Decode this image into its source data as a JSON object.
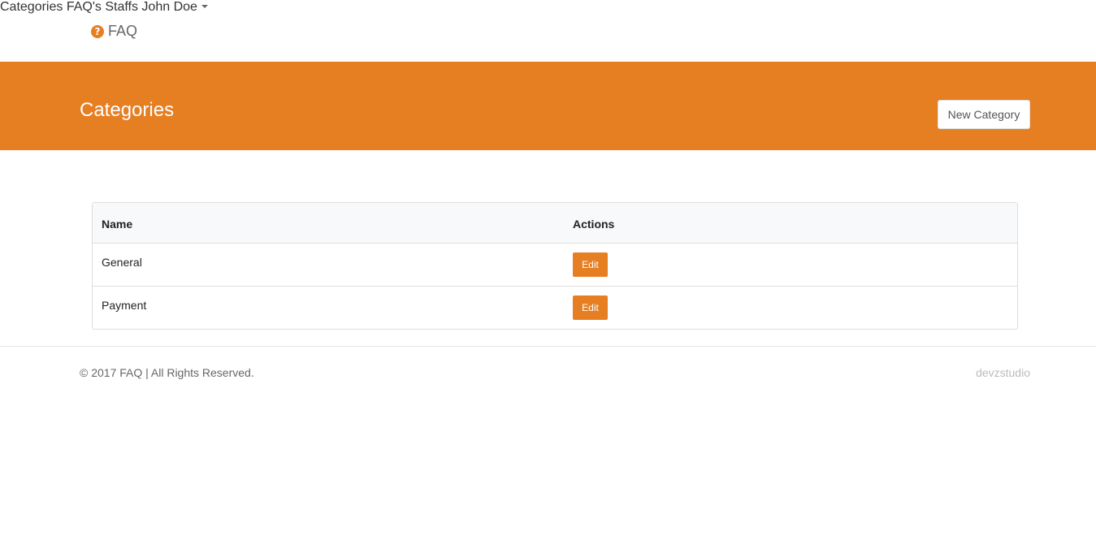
{
  "navbar": {
    "brand_icon": "question-circle-icon",
    "brand_text": "FAQ",
    "links": [
      {
        "label": "Categories"
      },
      {
        "label": "FAQ's"
      },
      {
        "label": "Staffs"
      }
    ],
    "user": {
      "label": "John Doe"
    }
  },
  "banner": {
    "title": "Categories",
    "new_button_label": "New Category"
  },
  "table": {
    "headers": [
      "Name",
      "Actions"
    ],
    "rows": [
      {
        "name": "General",
        "action_label": "Edit"
      },
      {
        "name": "Payment",
        "action_label": "Edit"
      }
    ]
  },
  "footer": {
    "copyright": "© 2017 FAQ | All Rights Reserved.",
    "credit": "devzstudio"
  },
  "colors": {
    "accent": "#e67e22",
    "nav_text": "#666666",
    "credit_text": "#bbbbbb"
  }
}
